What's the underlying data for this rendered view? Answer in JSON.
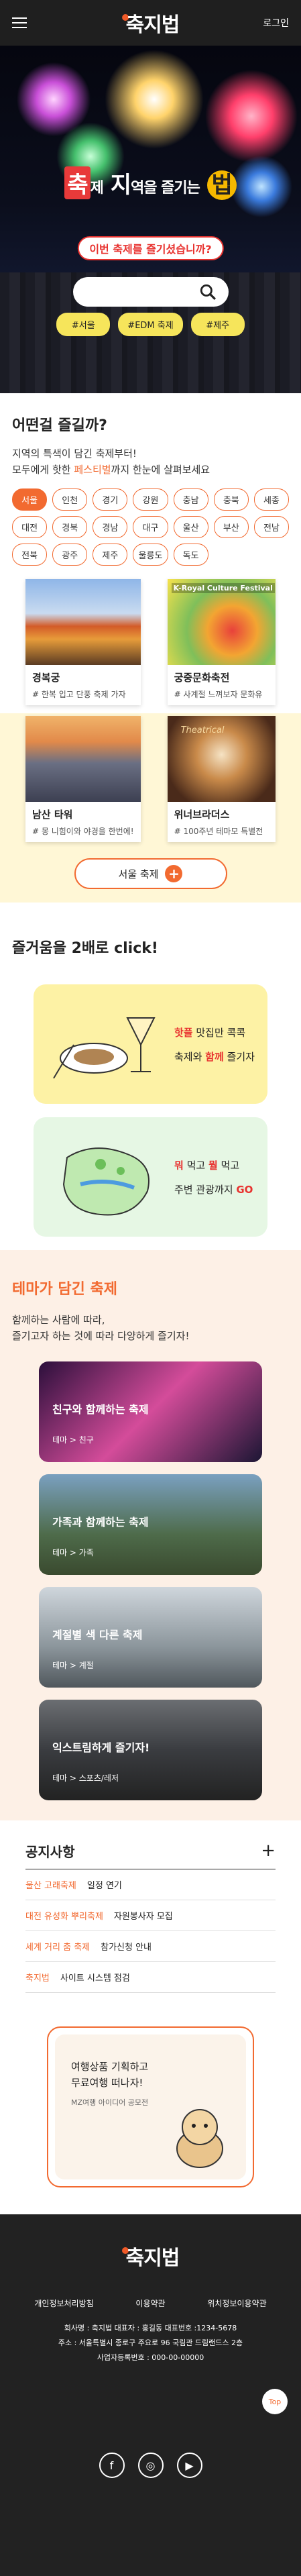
{
  "header": {
    "logo": "축지법",
    "login": "로그인"
  },
  "hero": {
    "title_a": "축",
    "title_b": "제",
    "title_c": "지",
    "title_d": "역을 즐기는",
    "title_e": "법",
    "subtitle": "이번 축제를 즐기셨습니까?",
    "tags": [
      "#서울",
      "#EDM 축제",
      "#제주"
    ]
  },
  "section1": {
    "title": "어떤걸 즐길까?",
    "desc1": "지역의 특색이 담긴 축제부터!",
    "desc2a": "모두에게 핫한 ",
    "desc2b": "페스티벌",
    "desc2c": "까지 한눈에 살펴보세요",
    "regions": [
      "서울",
      "인천",
      "경기",
      "강원",
      "충남",
      "충북",
      "세종",
      "대전",
      "경북",
      "경남",
      "대구",
      "울산",
      "부산",
      "전남",
      "전북",
      "광주",
      "제주",
      "울릉도",
      "독도"
    ],
    "cards": [
      {
        "title": "경복궁",
        "desc": "# 한복 입고 단풍 축제 가자"
      },
      {
        "title": "궁중문화축전",
        "desc": "# 사계절 느껴보자 문화유"
      },
      {
        "title": "남산 타워",
        "desc": "# 몽 니힘이와 야경을 한번에!"
      },
      {
        "title": "위너브라더스",
        "desc": "# 100주년 테마모 특별전"
      }
    ],
    "card2_text": "K-Royal Culture Festival",
    "card4_text": "Theatrical",
    "more": "서울 축제"
  },
  "section2": {
    "title": "즐거움을 2배로 click!",
    "box1a": "핫플",
    "box1b": " 맛집만 콕콕",
    "box1c": "축제와 ",
    "box1d": "함께",
    "box1e": " 즐기자",
    "box2a": "뭐",
    "box2b": " 먹고 ",
    "box2c": "뭘",
    "box2d": " 먹고",
    "box2e": "주변 관광까지 ",
    "box2f": "GO"
  },
  "theme": {
    "title": "테마가 담긴 축제",
    "desc1": "함께하는 사람에 따라,",
    "desc2": "즐기고자 하는 것에 따라 다양하게 즐기자!",
    "items": [
      {
        "t": "친구와 함께하는 축제",
        "s": "테마 > 친구"
      },
      {
        "t": "가족과 함께하는 축제",
        "s": "테마 > 가족"
      },
      {
        "t": "계절별 색 다른 축제",
        "s": "테마 > 계절"
      },
      {
        "t": "익스트림하게 즐기자!",
        "s": "테마 > 스포츠/레저"
      }
    ]
  },
  "notice": {
    "title": "공지사항",
    "items": [
      {
        "c": "울산 고래축제",
        "t": "일정 연기"
      },
      {
        "c": "대전 유성화 뿌리축제",
        "t": "자원봉사자 모집"
      },
      {
        "c": "세계 거리 춤 축제",
        "t": "참가신청 안내"
      },
      {
        "c": "축지법",
        "t": "사이트 시스템 점검"
      }
    ]
  },
  "promo": {
    "l1": "여행상품 기획하고",
    "l2": "무료여행 떠나자!",
    "l3": "MZ여행 아이디어 공모전"
  },
  "footer": {
    "logo": "축지법",
    "links": [
      "개인정보처리방침",
      "이용약관",
      "위치정보이용약관"
    ],
    "info1": "회사명 : 축지법    대표자 : 홍길동    대표번호 :1234-5678",
    "info2": "주소 : 서울특별시 종로구 주요로 96 국림관 드림랜드스 2층",
    "info3": "사업자등록번호 : 000-00-00000",
    "top": "Top"
  }
}
